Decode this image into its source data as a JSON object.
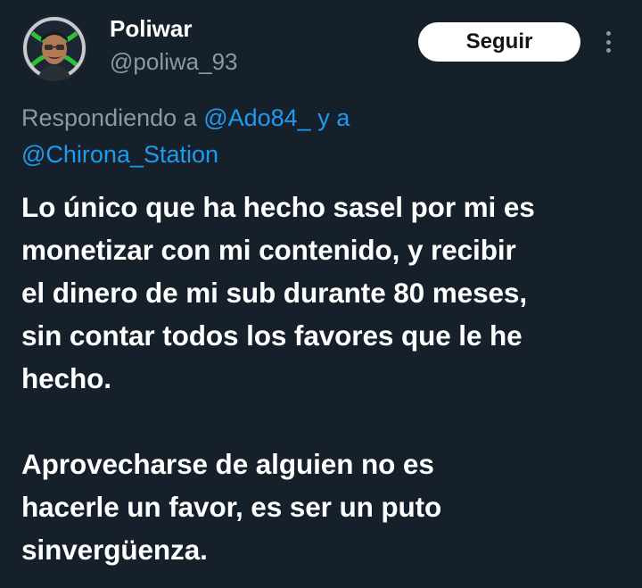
{
  "user": {
    "display_name": "Poliwar",
    "handle": "@poliwa_93",
    "avatar_icon": "xbox-avatar-icon"
  },
  "actions": {
    "follow_label": "Seguir",
    "more_icon": "more-options-icon"
  },
  "reply": {
    "prefix": "Respondiendo a",
    "mention_1": "@Ado84_",
    "connector": "y a",
    "mention_2": "@Chirona_Station"
  },
  "tweet": {
    "lines_p1": [
      "Lo único que ha hecho sasel por mi es",
      "monetizar con mi contenido, y recibir",
      "el dinero de mi sub durante 80 meses,",
      "sin contar todos los favores que le he",
      "hecho."
    ],
    "lines_p2": [
      "Aprovecharse de alguien no es",
      "hacerle un favor, es ser un puto",
      "sinvergüenza."
    ]
  },
  "colors": {
    "background": "#15202b",
    "link": "#1d9bf0",
    "secondary_text": "#8b98a5",
    "primary_text": "#ffffff",
    "avatar_ring": "#2fbf3a"
  }
}
